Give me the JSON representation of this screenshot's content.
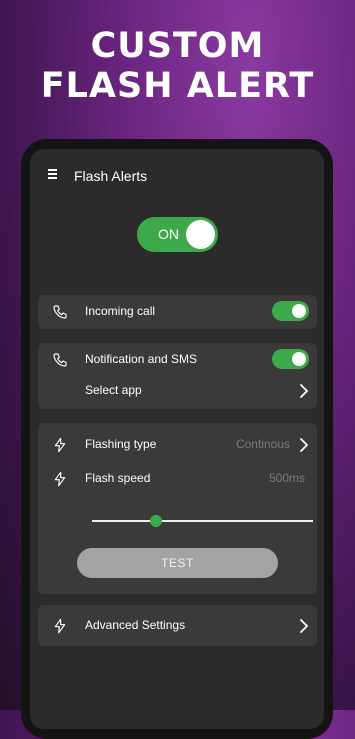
{
  "promo": {
    "headline_line1": "CUSTOM",
    "headline_line2": "FLASH ALERT"
  },
  "app": {
    "title": "Flash Alerts"
  },
  "main_switch": {
    "label": "ON",
    "state": "on"
  },
  "incoming_call": {
    "label": "Incoming call",
    "enabled": true
  },
  "notifications": {
    "label": "Notification and SMS",
    "enabled": true,
    "select_app_label": "Select app"
  },
  "flash": {
    "type_label": "Flashing type",
    "type_value": "Continous",
    "speed_label": "Flash speed",
    "speed_value": "500ms",
    "speed_slider_fraction": 0.29,
    "test_label": "TEST"
  },
  "advanced": {
    "label": "Advanced Settings"
  },
  "colors": {
    "accent": "#3ea94b",
    "card": "#3a3a3a",
    "screen": "#2b2b2b"
  },
  "icons": [
    "menu-icon",
    "phone-icon",
    "lightning-icon",
    "chevron-right-icon"
  ]
}
